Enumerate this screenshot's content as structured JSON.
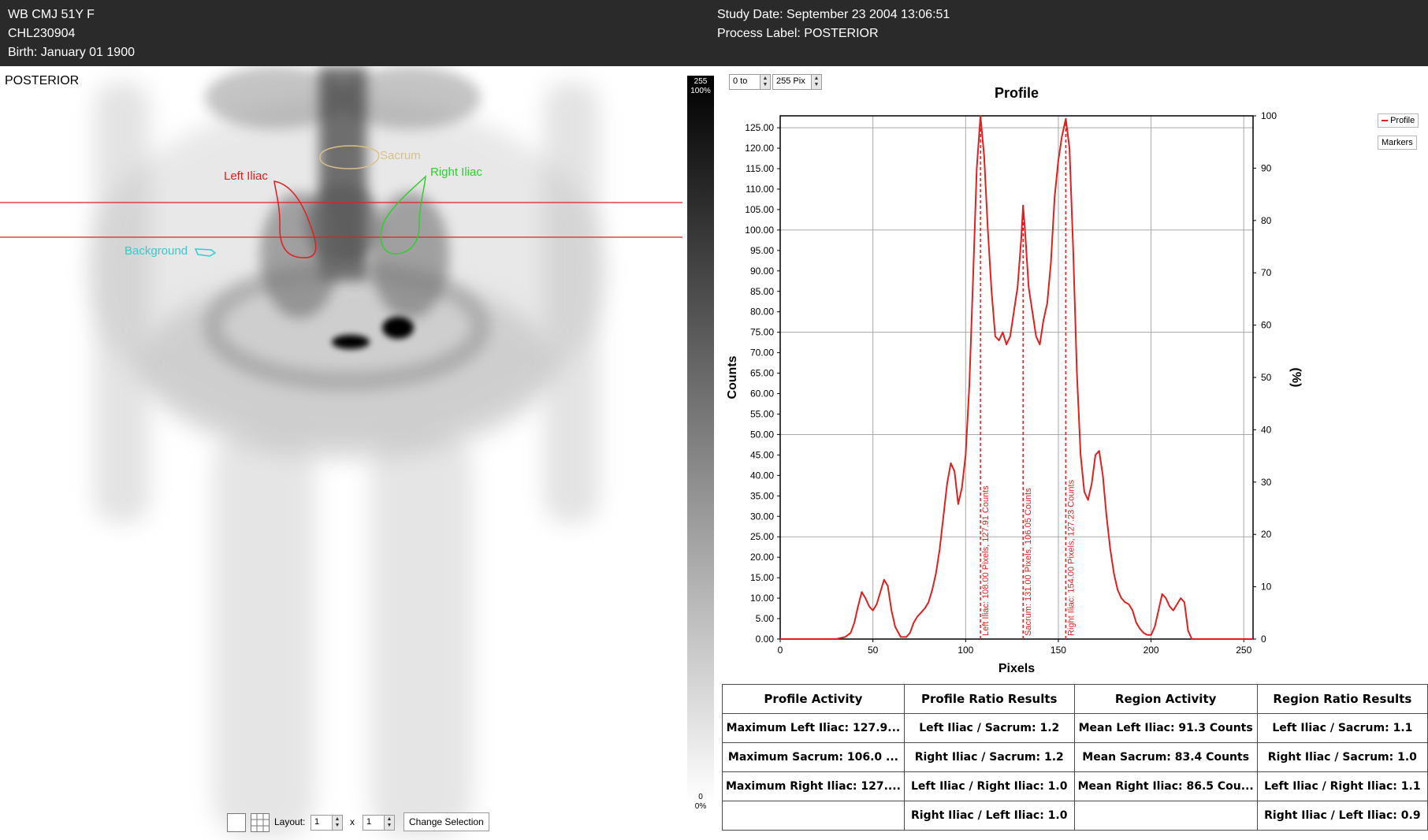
{
  "header": {
    "patient_line1": "WB CMJ 51Y F",
    "patient_id": "CHL230904",
    "birth": "Birth: January 01 1900",
    "study_date": "Study Date: September 23 2004 13:06:51",
    "process_label": "Process Label: POSTERIOR"
  },
  "viewer": {
    "view_label": "POSTERIOR",
    "roi_labels": {
      "sacrum": "Sacrum",
      "left_iliac": "Left Iliac",
      "right_iliac": "Right Iliac",
      "background": "Background"
    },
    "roi_colors": {
      "sacrum": "#d9c08a",
      "left_iliac": "#e02020",
      "right_iliac": "#33cc33",
      "background": "#33cccc",
      "profile_lines": "#e02020"
    },
    "colorbar": {
      "max_value": "255",
      "max_pct": "100%",
      "min_value": "0",
      "min_pct": "0%"
    },
    "bottom_toolbar": {
      "layout_label": "Layout:",
      "rows": "1",
      "times": "x",
      "cols": "1",
      "change_selection": "Change Selection",
      "icons": [
        "single-view-icon",
        "grid-view-icon"
      ]
    }
  },
  "profile_controls": {
    "range_start": "0 to",
    "range_end": "255 Pix"
  },
  "legend": {
    "profile": "Profile",
    "markers": "Markers"
  },
  "chart_data": {
    "type": "line",
    "title": "Profile",
    "xlabel": "Pixels",
    "ylabel": "Counts",
    "y2label": "(%)",
    "xlim": [
      0,
      255
    ],
    "ylim": [
      0,
      127.91
    ],
    "x_ticks": [
      0,
      50,
      100,
      150,
      200,
      250
    ],
    "y_ticks": [
      0,
      5,
      10,
      15,
      20,
      25,
      30,
      35,
      40,
      45,
      50,
      55,
      60,
      65,
      70,
      75,
      80,
      85,
      90,
      95,
      100,
      105,
      110,
      115,
      120,
      125
    ],
    "y2_ticks": [
      0,
      10,
      20,
      30,
      40,
      50,
      60,
      70,
      80,
      90,
      100
    ],
    "grid": true,
    "legend_position": "top-right",
    "series": [
      {
        "name": "Profile",
        "color": "#e02020",
        "x": [
          0,
          30,
          35,
          38,
          40,
          42,
          44,
          46,
          48,
          50,
          52,
          54,
          56,
          58,
          60,
          62,
          65,
          68,
          70,
          72,
          74,
          76,
          78,
          80,
          82,
          84,
          86,
          88,
          90,
          92,
          94,
          96,
          98,
          100,
          102,
          104,
          106,
          108,
          110,
          112,
          114,
          116,
          118,
          120,
          122,
          124,
          126,
          128,
          130,
          131,
          132,
          134,
          136,
          138,
          140,
          142,
          144,
          146,
          148,
          150,
          152,
          154,
          156,
          158,
          160,
          162,
          164,
          166,
          168,
          170,
          172,
          174,
          176,
          178,
          180,
          182,
          184,
          186,
          188,
          190,
          192,
          194,
          196,
          198,
          200,
          202,
          204,
          206,
          208,
          210,
          212,
          214,
          216,
          218,
          220,
          222,
          224,
          230,
          240,
          255
        ],
        "y": [
          0,
          0,
          0.5,
          1.5,
          4,
          8,
          11.5,
          10,
          8,
          7,
          8.5,
          11.5,
          14.5,
          13,
          7,
          3,
          0.5,
          0.5,
          1.5,
          4,
          5.5,
          6.5,
          7.5,
          9,
          12,
          16,
          22,
          30,
          38,
          43,
          41,
          33,
          37,
          45,
          62,
          88,
          115,
          127.9,
          118,
          100,
          85,
          74,
          73,
          75,
          72,
          74,
          80,
          86,
          98,
          106,
          100,
          86,
          80,
          74,
          72,
          78,
          82,
          92,
          108,
          117,
          123,
          127.2,
          120,
          95,
          65,
          45,
          36,
          34,
          38,
          45,
          46,
          40,
          30,
          22,
          16,
          12,
          10,
          9,
          8.5,
          7,
          4,
          2.5,
          1.5,
          1,
          1,
          3,
          7,
          11,
          10,
          8,
          7,
          8.5,
          10,
          9,
          2,
          0,
          0,
          0,
          0,
          0
        ]
      }
    ],
    "markers": [
      {
        "name": "Left Iliac",
        "x": 108,
        "y": 127.91,
        "label": "Left Iliac: 108.00 Pixels, 127.91 Counts"
      },
      {
        "name": "Sacrum",
        "x": 131,
        "y": 106.05,
        "label": "Sacrum: 131.00 Pixels, 106.05 Counts"
      },
      {
        "name": "Right Iliac",
        "x": 154,
        "y": 127.23,
        "label": "Right Iliac: 154.00 Pixels, 127.23 Counts"
      }
    ]
  },
  "results_table": {
    "headers": [
      "Profile Activity",
      "Profile Ratio Results",
      "Region Activity",
      "Region Ratio Results"
    ],
    "rows": [
      [
        "Maximum Left Iliac: 127.9...",
        "Left Iliac / Sacrum: 1.2",
        "Mean Left Iliac: 91.3 Counts",
        "Left Iliac / Sacrum: 1.1"
      ],
      [
        "Maximum Sacrum: 106.0 ...",
        "Right Iliac / Sacrum: 1.2",
        "Mean Sacrum: 83.4 Counts",
        "Right Iliac / Sacrum: 1.0"
      ],
      [
        "Maximum Right Iliac: 127....",
        "Left Iliac / Right Iliac: 1.0",
        "Mean Right Iliac: 86.5 Cou...",
        "Left Iliac / Right Iliac: 1.1"
      ],
      [
        "",
        "Right Iliac / Left Iliac: 1.0",
        "",
        "Right Iliac / Left Iliac: 0.9"
      ]
    ]
  }
}
